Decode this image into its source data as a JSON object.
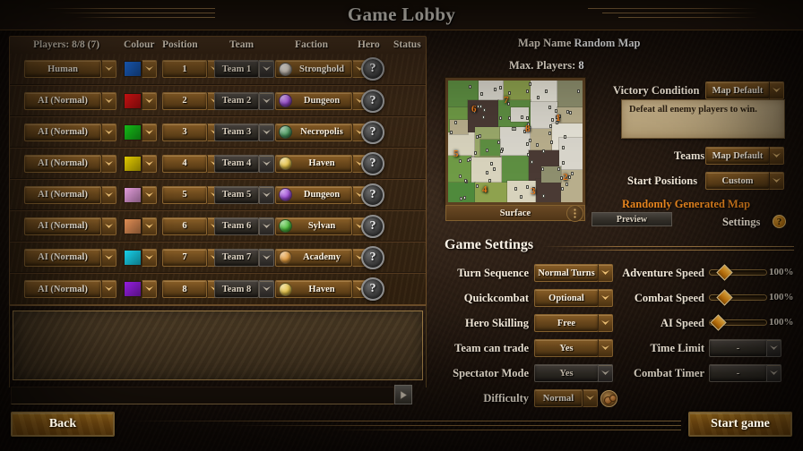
{
  "window": {
    "title": "Game Lobby"
  },
  "players_table": {
    "headers": {
      "players": "Players: 8/8 (7)",
      "colour": "Colour",
      "position": "Position",
      "team": "Team",
      "faction": "Faction",
      "hero": "Hero",
      "status": "Status"
    },
    "hero_placeholder": "?",
    "rows": [
      {
        "player": "Human",
        "colour": "#1f6fe0",
        "colour_name": "blue",
        "position": "1",
        "team": "Team 1",
        "faction": "Stronghold",
        "faction_color": "#d8cfc4",
        "hero": "?",
        "status": ""
      },
      {
        "player": "AI (Normal)",
        "colour": "#e01414",
        "colour_name": "red",
        "position": "2",
        "team": "Team 2",
        "faction": "Dungeon",
        "faction_color": "#a04fd8",
        "hero": "?",
        "status": ""
      },
      {
        "player": "AI (Normal)",
        "colour": "#17c61a",
        "colour_name": "green",
        "position": "3",
        "team": "Team 3",
        "faction": "Necropolis",
        "faction_color": "#4e9e62",
        "hero": "?",
        "status": ""
      },
      {
        "player": "AI (Normal)",
        "colour": "#ecd300",
        "colour_name": "yellow",
        "position": "4",
        "team": "Team 4",
        "faction": "Haven",
        "faction_color": "#e6c44a",
        "hero": "?",
        "status": ""
      },
      {
        "player": "AI (Normal)",
        "colour": "#eba2e3",
        "colour_name": "pink",
        "position": "5",
        "team": "Team 5",
        "faction": "Dungeon",
        "faction_color": "#a04fd8",
        "hero": "?",
        "status": ""
      },
      {
        "player": "AI (Normal)",
        "colour": "#e79257",
        "colour_name": "orange",
        "position": "6",
        "team": "Team 6",
        "faction": "Sylvan",
        "faction_color": "#4fbf3d",
        "hero": "?",
        "status": ""
      },
      {
        "player": "AI (Normal)",
        "colour": "#19d8f2",
        "colour_name": "cyan",
        "position": "7",
        "team": "Team 7",
        "faction": "Academy",
        "faction_color": "#e09a3e",
        "hero": "?",
        "status": ""
      },
      {
        "player": "AI (Normal)",
        "colour": "#9b1fe8",
        "colour_name": "purple",
        "position": "8",
        "team": "Team 8",
        "faction": "Haven",
        "faction_color": "#e6c44a",
        "hero": "?",
        "status": ""
      }
    ]
  },
  "chat": {
    "input_value": "",
    "send_icon": "send-icon"
  },
  "footer": {
    "back_label": "Back",
    "start_label": "Start game"
  },
  "map_info": {
    "map_name_label": "Map Name",
    "map_name_value": "Random Map",
    "max_players_label": "Max. Players:",
    "max_players_value": "8",
    "surface_label": "Surface",
    "randomly_generated": "Randomly Generated Map",
    "preview_label": "Preview",
    "settings_label": "Settings",
    "settings_help": "?",
    "minimap_positions": [
      "1",
      "2",
      "3",
      "4",
      "5",
      "6",
      "7",
      "8"
    ]
  },
  "map_options": {
    "victory_condition_label": "Victory Condition",
    "victory_condition_value": "Map Default",
    "victory_description": "Defeat all enemy players to win.",
    "teams_label": "Teams",
    "teams_value": "Map Default",
    "start_positions_label": "Start Positions",
    "start_positions_value": "Custom"
  },
  "game_settings": {
    "section_title": "Game Settings",
    "left_column": [
      {
        "label": "Turn Sequence",
        "value": "Normal Turns",
        "disabled": false
      },
      {
        "label": "Quickcombat",
        "value": "Optional",
        "disabled": false
      },
      {
        "label": "Hero Skilling",
        "value": "Free",
        "disabled": false
      },
      {
        "label": "Team can trade",
        "value": "Yes",
        "disabled": false
      },
      {
        "label": "Spectator Mode",
        "value": "Yes",
        "disabled": true
      },
      {
        "label": "Difficulty",
        "value": "Normal",
        "disabled": false
      }
    ],
    "sliders": [
      {
        "label": "Adventure Speed",
        "value": "100%",
        "percent": 22
      },
      {
        "label": "Combat Speed",
        "value": "100%",
        "percent": 22
      },
      {
        "label": "AI Speed",
        "value": "100%",
        "percent": 8
      }
    ],
    "right_column": [
      {
        "label": "Time Limit",
        "value": "-",
        "disabled": true
      },
      {
        "label": "Combat Timer",
        "value": "-",
        "disabled": true
      }
    ]
  },
  "colors": {
    "accent_orange": "#e8861f",
    "gold": "#c59a4e",
    "panel_brown": "#3b2817"
  }
}
